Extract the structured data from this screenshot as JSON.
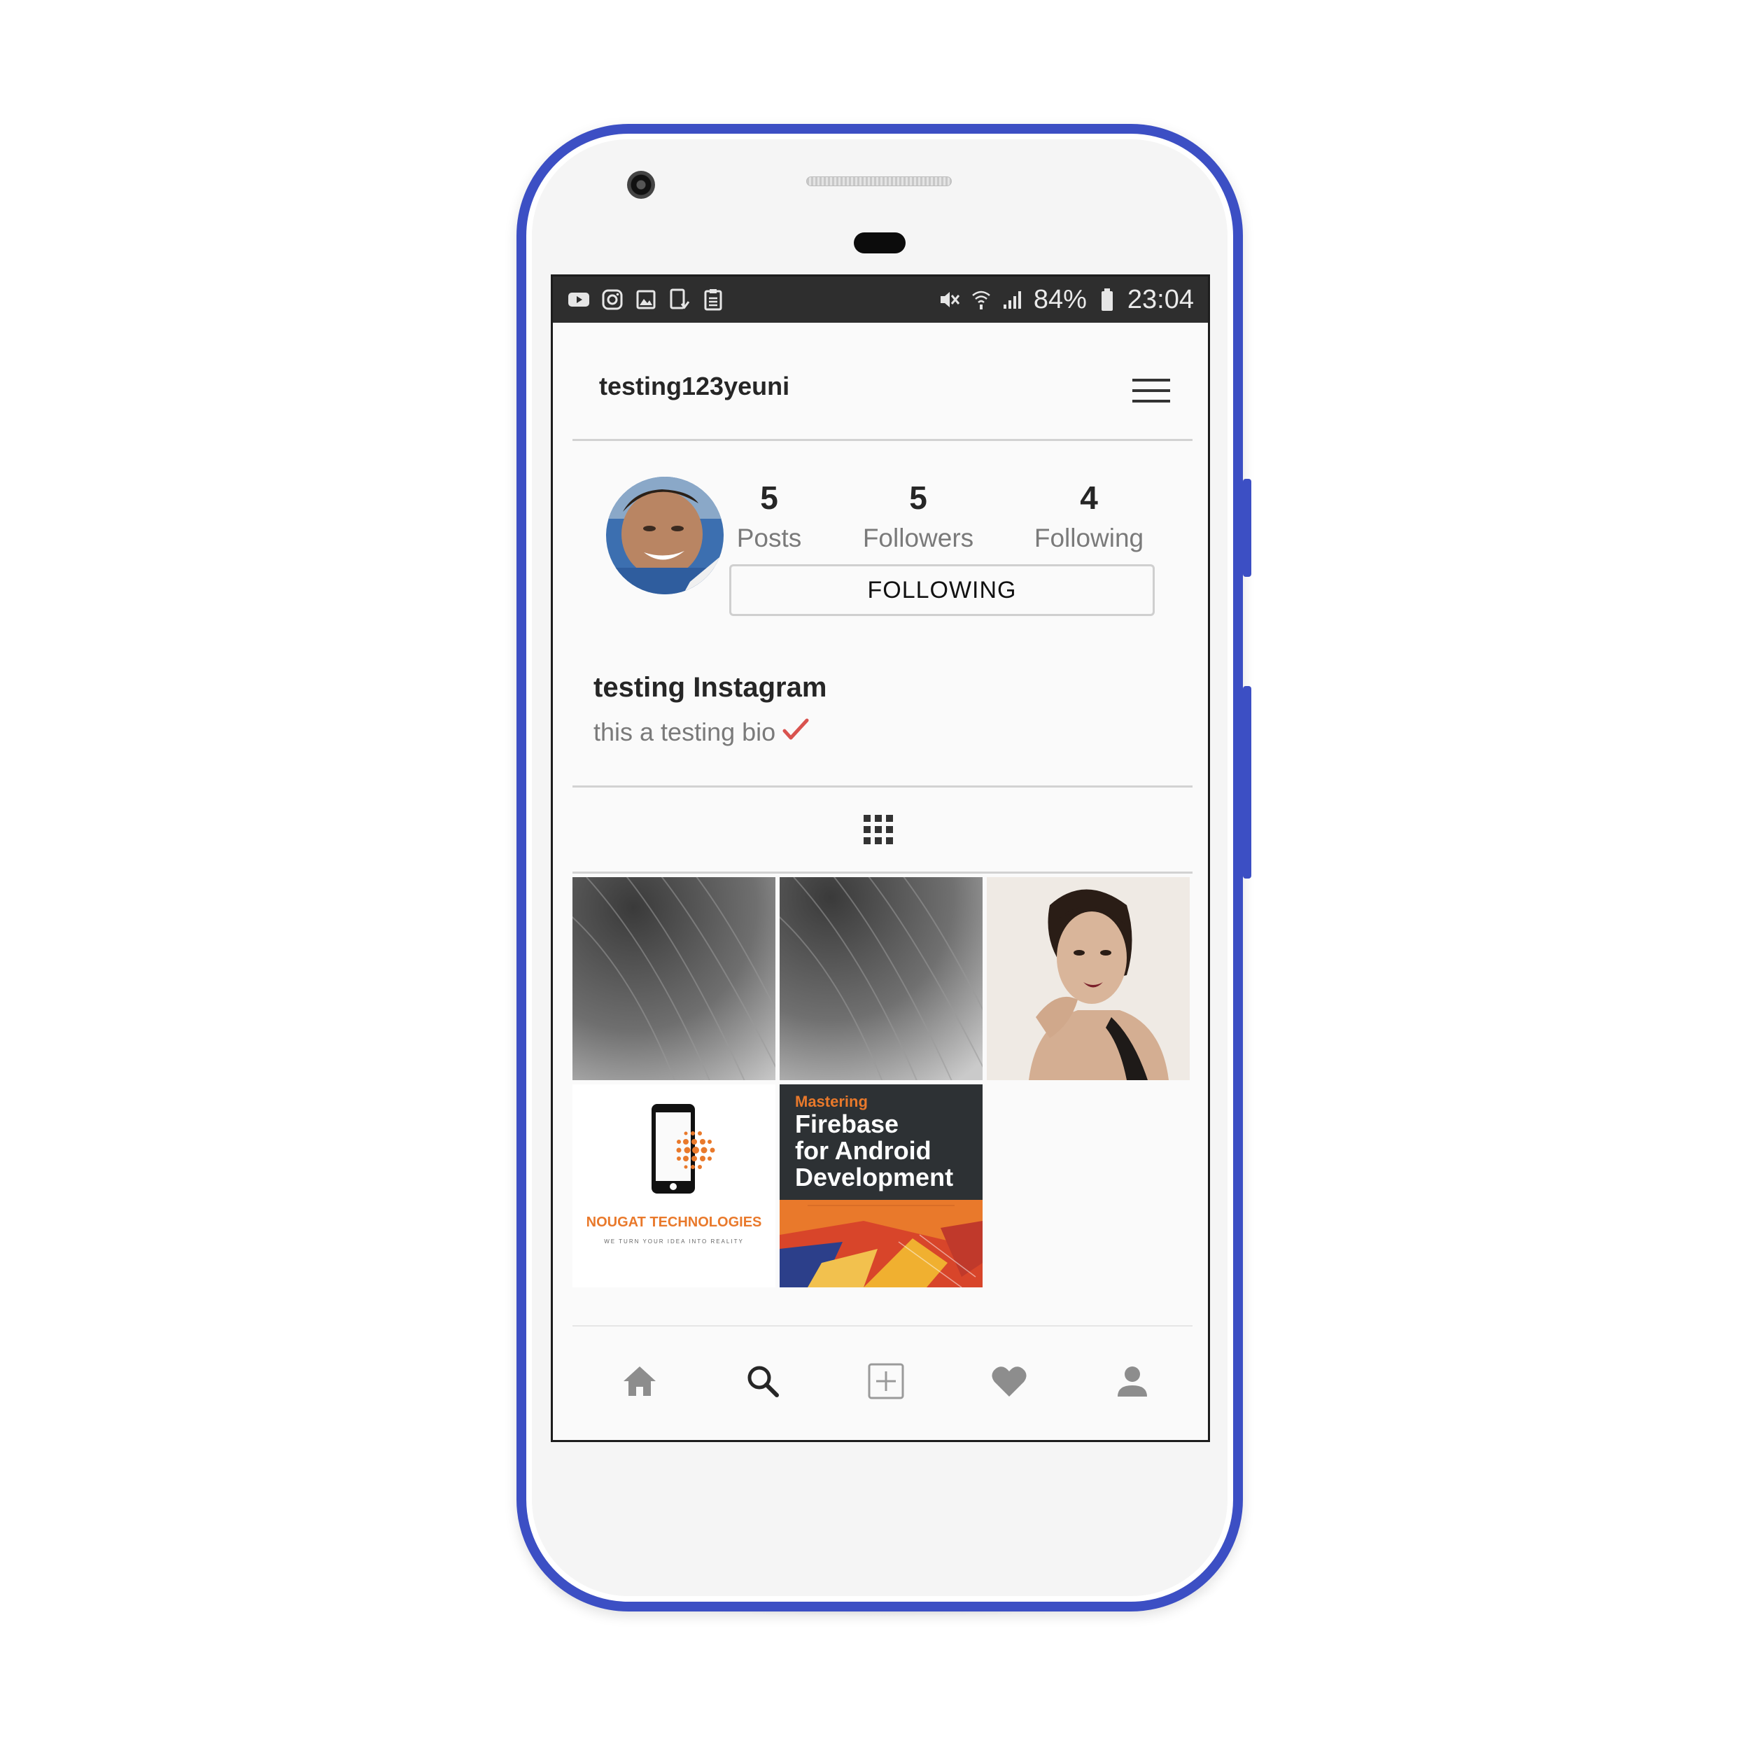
{
  "status_bar": {
    "left_icons": [
      "youtube-icon",
      "instagram-icon",
      "gallery-icon",
      "device-icon",
      "clipboard-icon"
    ],
    "right_icons": [
      "mute-icon",
      "wifi-icon",
      "signal-icon"
    ],
    "battery": "84%",
    "time": "23:04"
  },
  "header": {
    "username": "testing123yeuni",
    "menu_icon": "hamburger-menu-icon"
  },
  "profile": {
    "stats": [
      {
        "value": "5",
        "label": "Posts"
      },
      {
        "value": "5",
        "label": "Followers"
      },
      {
        "value": "4",
        "label": "Following"
      }
    ],
    "follow_button_label": "FOLLOWING",
    "display_name": "testing Instagram",
    "bio": "this a testing bio"
  },
  "posts_grid": {
    "icon": "grid-icon",
    "posts": [
      {
        "kind": "gray-abstract"
      },
      {
        "kind": "gray-abstract"
      },
      {
        "kind": "portrait"
      },
      {
        "kind": "logo",
        "title": "NOUGAT TECHNOLOGIES",
        "tagline": "WE TURN YOUR IDEA INTO REALITY"
      },
      {
        "kind": "book-cover",
        "line1": "Mastering",
        "line2": "Firebase",
        "line3": "for Android",
        "line4": "Development"
      }
    ]
  },
  "bottom_nav": [
    "home-icon",
    "search-icon",
    "add-post-icon",
    "heart-icon",
    "profile-icon"
  ],
  "colors": {
    "phone_frame": "#3c4fc4",
    "status_bar": "#2e2e2e",
    "accent_orange": "#e9792b",
    "check_red": "#d9534f"
  }
}
